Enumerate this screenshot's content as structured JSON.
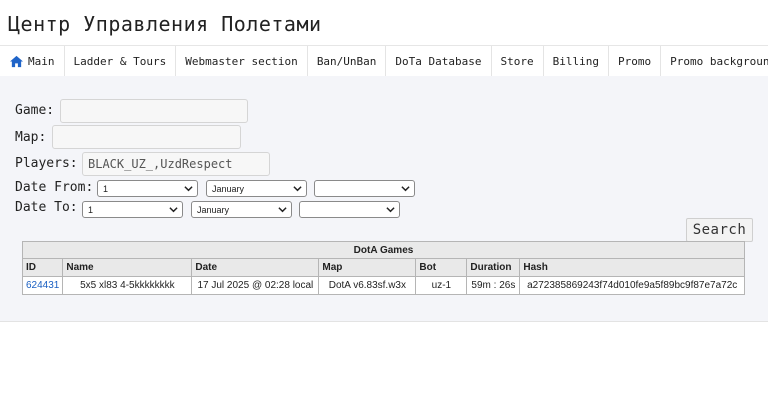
{
  "header": {
    "title": "Центр Управления Полетами"
  },
  "nav": {
    "items": [
      {
        "label": "Main",
        "icon": "home-icon"
      },
      {
        "label": "Ladder & Tours"
      },
      {
        "label": "Webmaster section"
      },
      {
        "label": "Ban/UnBan"
      },
      {
        "label": "DoTa Database"
      },
      {
        "label": "Store"
      },
      {
        "label": "Billing"
      },
      {
        "label": "Promo"
      },
      {
        "label": "Promo background"
      }
    ]
  },
  "form": {
    "game_label": "Game:",
    "game_value": "",
    "map_label": "Map:",
    "map_value": "",
    "players_label": "Players:",
    "players_value": "BLACK_UZ_,UzdRespect",
    "date_from_label": "Date From:",
    "date_from": {
      "day": "1",
      "month": "January",
      "year": ""
    },
    "date_to_label": "Date To:",
    "date_to": {
      "day": "1",
      "month": "January",
      "year": ""
    },
    "search_label": "Search"
  },
  "table": {
    "caption": "DotA Games",
    "columns": [
      "ID",
      "Name",
      "Date",
      "Map",
      "Bot",
      "Duration",
      "Hash"
    ],
    "rows": [
      [
        "624431",
        "5x5 xl83 4-5kkkkkkkk",
        "17 Jul 2025 @ 02:28 local",
        "DotA v6.83sf.w3x",
        "uz-1",
        "59m : 26s",
        "a272385869243f74d010fe9a5f89bc9f87e7a72c"
      ]
    ]
  },
  "colors": {
    "accent": "#1a5fc2",
    "content_bg": "#f4f5f9",
    "header_bg": "#e9e9e9"
  }
}
